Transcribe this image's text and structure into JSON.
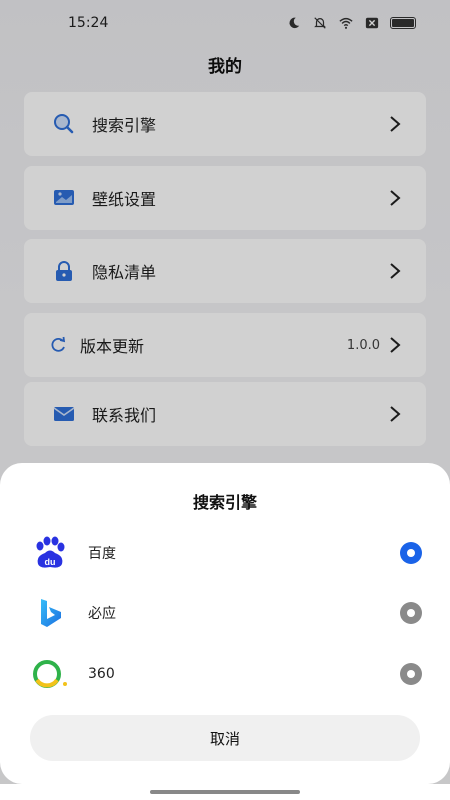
{
  "status_bar": {
    "time": "15:24",
    "icons": [
      "moon-icon",
      "mute-icon",
      "wifi-icon",
      "sim-off-icon",
      "battery-icon"
    ]
  },
  "page": {
    "title": "我的",
    "menu": [
      {
        "label": "搜索引擎",
        "icon": "search-icon",
        "value": ""
      },
      {
        "label": "壁纸设置",
        "icon": "wallpaper-icon",
        "value": ""
      },
      {
        "label": "隐私清单",
        "icon": "lock-icon",
        "value": ""
      },
      {
        "label": "版本更新",
        "icon": "refresh-icon",
        "value": "1.0.0"
      },
      {
        "label": "联系我们",
        "icon": "mail-icon",
        "value": ""
      }
    ]
  },
  "sheet": {
    "title": "搜索引擎",
    "options": [
      {
        "label": "百度",
        "icon": "baidu-logo-icon",
        "selected": true
      },
      {
        "label": "必应",
        "icon": "bing-logo-icon",
        "selected": false
      },
      {
        "label": "360",
        "icon": "360-logo-icon",
        "selected": false
      }
    ],
    "cancel_label": "取消"
  },
  "colors": {
    "accent": "#1a63e8",
    "radio_off": "#8a8a8a",
    "icon_blue": "#2f6fd8"
  }
}
